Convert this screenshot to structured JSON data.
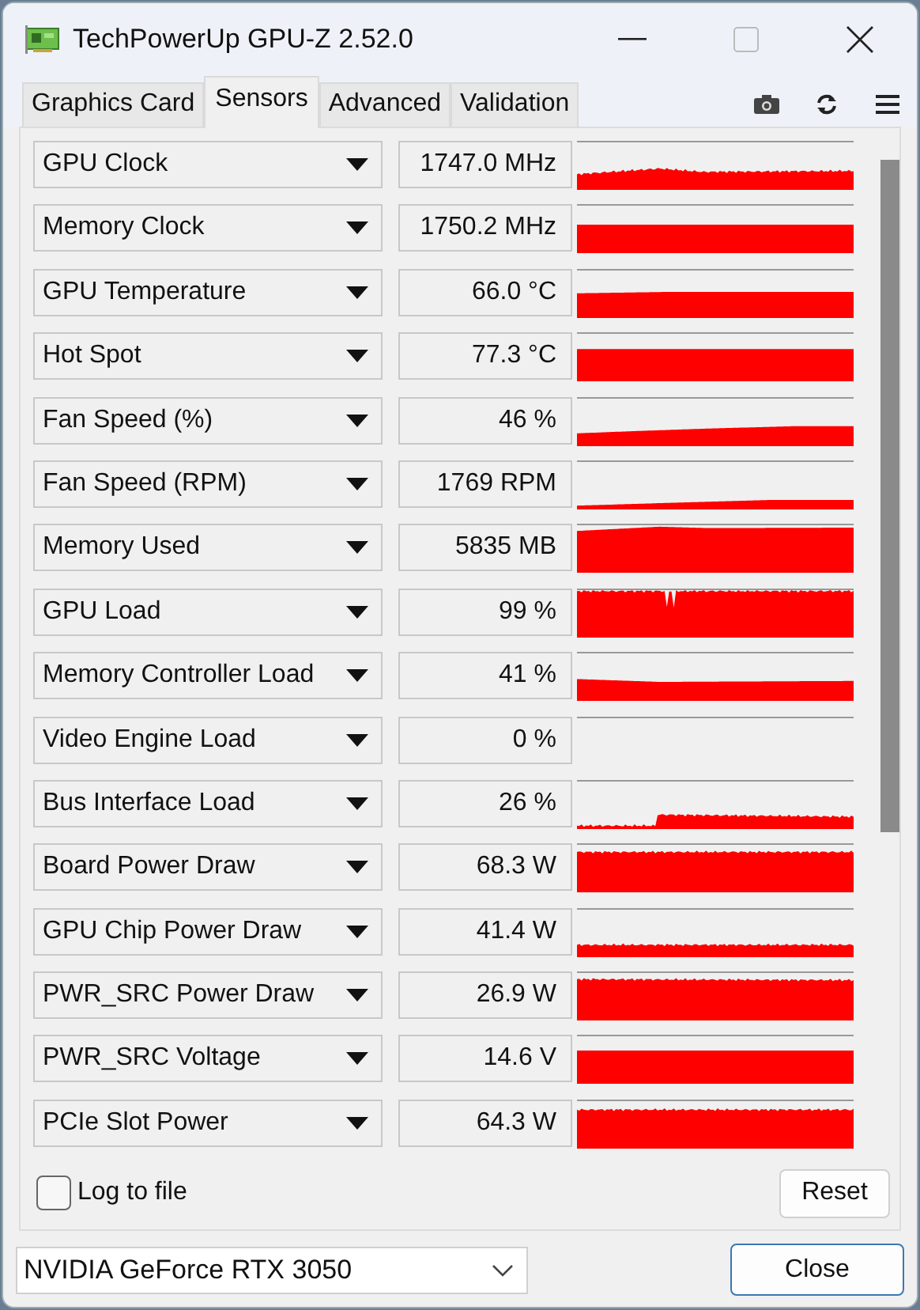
{
  "window": {
    "title": "TechPowerUp GPU-Z 2.52.0"
  },
  "tabs": [
    {
      "label": "Graphics Card",
      "selected": false
    },
    {
      "label": "Sensors",
      "selected": true
    },
    {
      "label": "Advanced",
      "selected": false
    },
    {
      "label": "Validation",
      "selected": false
    }
  ],
  "sensors": [
    {
      "name": "GPU Clock",
      "value": "1747.0 MHz"
    },
    {
      "name": "Memory Clock",
      "value": "1750.2 MHz"
    },
    {
      "name": "GPU Temperature",
      "value": "66.0 °C"
    },
    {
      "name": "Hot Spot",
      "value": "77.3 °C"
    },
    {
      "name": "Fan Speed (%)",
      "value": "46 %"
    },
    {
      "name": "Fan Speed (RPM)",
      "value": "1769 RPM"
    },
    {
      "name": "Memory Used",
      "value": "5835 MB"
    },
    {
      "name": "GPU Load",
      "value": "99 %"
    },
    {
      "name": "Memory Controller Load",
      "value": "41 %"
    },
    {
      "name": "Video Engine Load",
      "value": "0 %"
    },
    {
      "name": "Bus Interface Load",
      "value": "26 %"
    },
    {
      "name": "Board Power Draw",
      "value": "68.3 W"
    },
    {
      "name": "GPU Chip Power Draw",
      "value": "41.4 W"
    },
    {
      "name": "PWR_SRC Power Draw",
      "value": "26.9 W"
    },
    {
      "name": "PWR_SRC Voltage",
      "value": "14.6 V"
    },
    {
      "name": "PCIe Slot Power",
      "value": "64.3 W"
    }
  ],
  "log_to_file": {
    "label": "Log to file",
    "checked": false
  },
  "reset_button": "Reset",
  "gpu_select": {
    "value": "NVIDIA GeForce RTX 3050"
  },
  "close_button": "Close"
}
